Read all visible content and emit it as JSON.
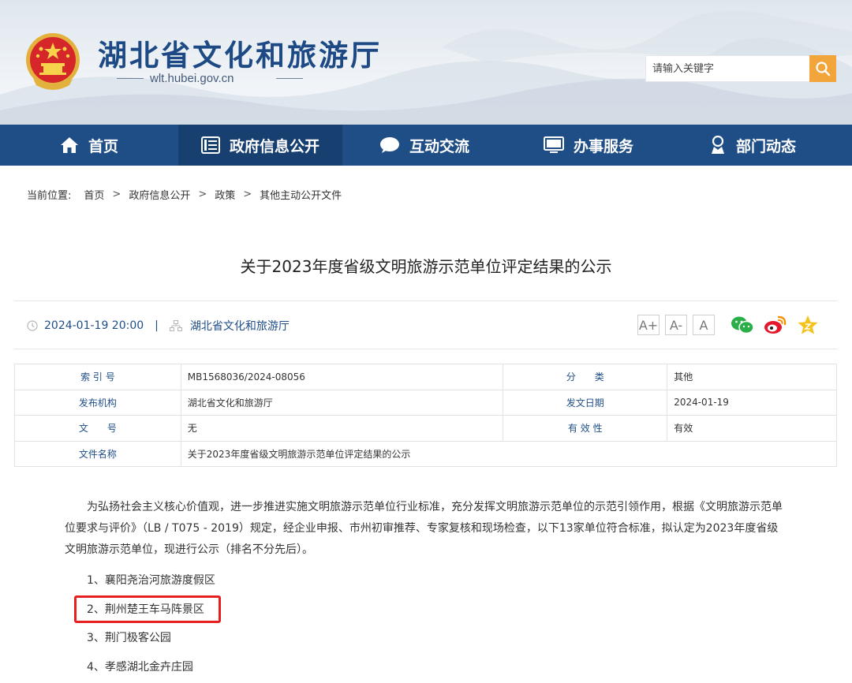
{
  "header": {
    "site_title": "湖北省文化和旅游厅",
    "domain": "wlt.hubei.gov.cn",
    "search_placeholder": "请输入关键字"
  },
  "nav": {
    "items": [
      {
        "label": "首页",
        "icon": "home-icon"
      },
      {
        "label": "政府信息公开",
        "icon": "document-list-icon",
        "active": true
      },
      {
        "label": "互动交流",
        "icon": "chat-bubble-icon"
      },
      {
        "label": "办事服务",
        "icon": "monitor-icon"
      },
      {
        "label": "部门动态",
        "icon": "person-badge-icon"
      }
    ]
  },
  "breadcrumb": {
    "lead": "当前位置:",
    "items": [
      "首页",
      "政府信息公开",
      "政策",
      "其他主动公开文件"
    ],
    "separator": ">"
  },
  "article": {
    "title": "关于2023年度省级文明旅游示范单位评定结果的公示",
    "datetime": "2024-01-19 20:00",
    "pipe": "|",
    "source": "湖北省文化和旅游厅",
    "font_sizes": [
      "A+",
      "A-",
      "A"
    ]
  },
  "info_table": {
    "rows": [
      {
        "k1": "索 引 号",
        "v1": "MB1568036/2024-08056",
        "k2": "分　　类",
        "v2": "其他"
      },
      {
        "k1": "发布机构",
        "v1": "湖北省文化和旅游厅",
        "k2": "发文日期",
        "v2": "2024-01-19"
      },
      {
        "k1": "文　　号",
        "v1": "无",
        "k2": "有 效 性",
        "v2": "有效"
      },
      {
        "k1": "文件名称",
        "v1": "关于2023年度省级文明旅游示范单位评定结果的公示"
      }
    ]
  },
  "body": {
    "paragraph": "为弘扬社会主义核心价值观，进一步推进实施文明旅游示范单位行业标准，充分发挥文明旅游示范单位的示范引领作用，根据《文明旅游示范单位要求与评价》（LB / T075 - 2019）规定，经企业申报、市州初审推荐、专家复核和现场检查，以下13家单位符合标准，拟认定为2023年度省级文明旅游示范单位，现进行公示（排名不分先后）。",
    "list": [
      "1、襄阳尧治河旅游度假区",
      "2、荆州楚王车马阵景区",
      "3、荆门极客公园",
      "4、孝感湖北金卉庄园"
    ]
  },
  "colors": {
    "brand_blue": "#1f4e87",
    "nav_active": "#173f70",
    "search_orange": "#f2a53a",
    "highlight_red": "#e62020"
  }
}
